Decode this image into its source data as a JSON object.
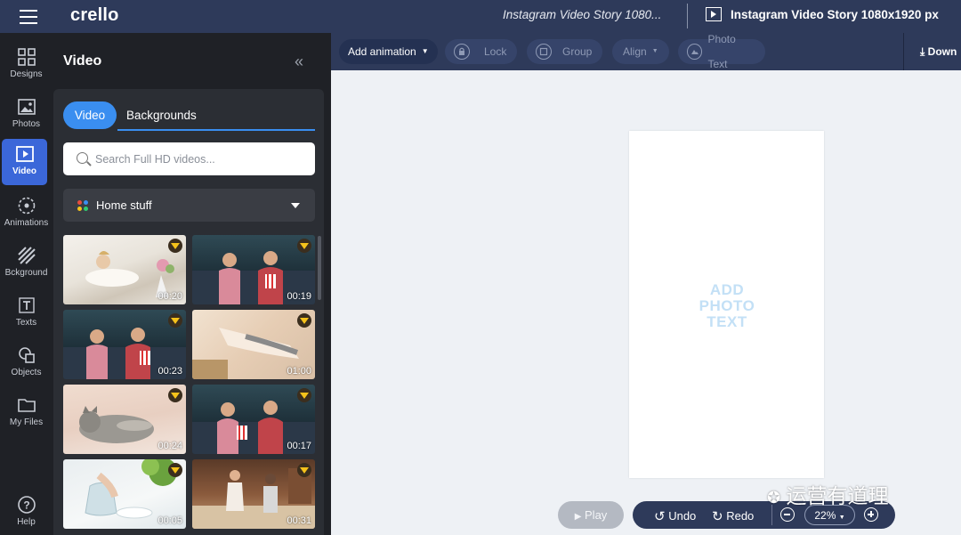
{
  "app": {
    "logo": "crello",
    "doc_title": "Instagram Video Story 1080...",
    "size_label": "Instagram Video Story 1080x1920 px"
  },
  "rail": [
    {
      "label": "Designs",
      "icon": "designs-grid-icon"
    },
    {
      "label": "Photos",
      "icon": "photo-icon"
    },
    {
      "label": "Video",
      "icon": "video-icon"
    },
    {
      "label": "Animations",
      "icon": "animations-icon"
    },
    {
      "label": "Bckground",
      "icon": "background-icon"
    },
    {
      "label": "Texts",
      "icon": "text-icon"
    },
    {
      "label": "Objects",
      "icon": "objects-icon"
    },
    {
      "label": "My Files",
      "icon": "folder-icon"
    },
    {
      "label": "Help",
      "icon": "help-icon"
    }
  ],
  "panel": {
    "title": "Video",
    "tabs": [
      "Video",
      "Backgrounds"
    ],
    "search_placeholder": "Search Full HD videos...",
    "category": "Home stuff",
    "thumbs": [
      {
        "duration": "00:20"
      },
      {
        "duration": "00:19"
      },
      {
        "duration": "00:23"
      },
      {
        "duration": "01:00"
      },
      {
        "duration": "00:24"
      },
      {
        "duration": "00:17"
      },
      {
        "duration": "00:05"
      },
      {
        "duration": "00:31"
      }
    ]
  },
  "toolbar": {
    "add_animation": "Add animation",
    "lock": "Lock",
    "group": "Group",
    "align": "Align",
    "photo_text": "Photo Text",
    "download": "Down"
  },
  "canvas": {
    "placeholder": "ADD PHOTO TEXT"
  },
  "controls": {
    "play": "Play",
    "undo": "Undo",
    "redo": "Redo",
    "zoom": "22%"
  },
  "watermark": "运营有道理",
  "colors": {
    "topbar": "#2e3a5a",
    "accent": "#3a8ef0",
    "rail_active": "#3b67d9"
  }
}
